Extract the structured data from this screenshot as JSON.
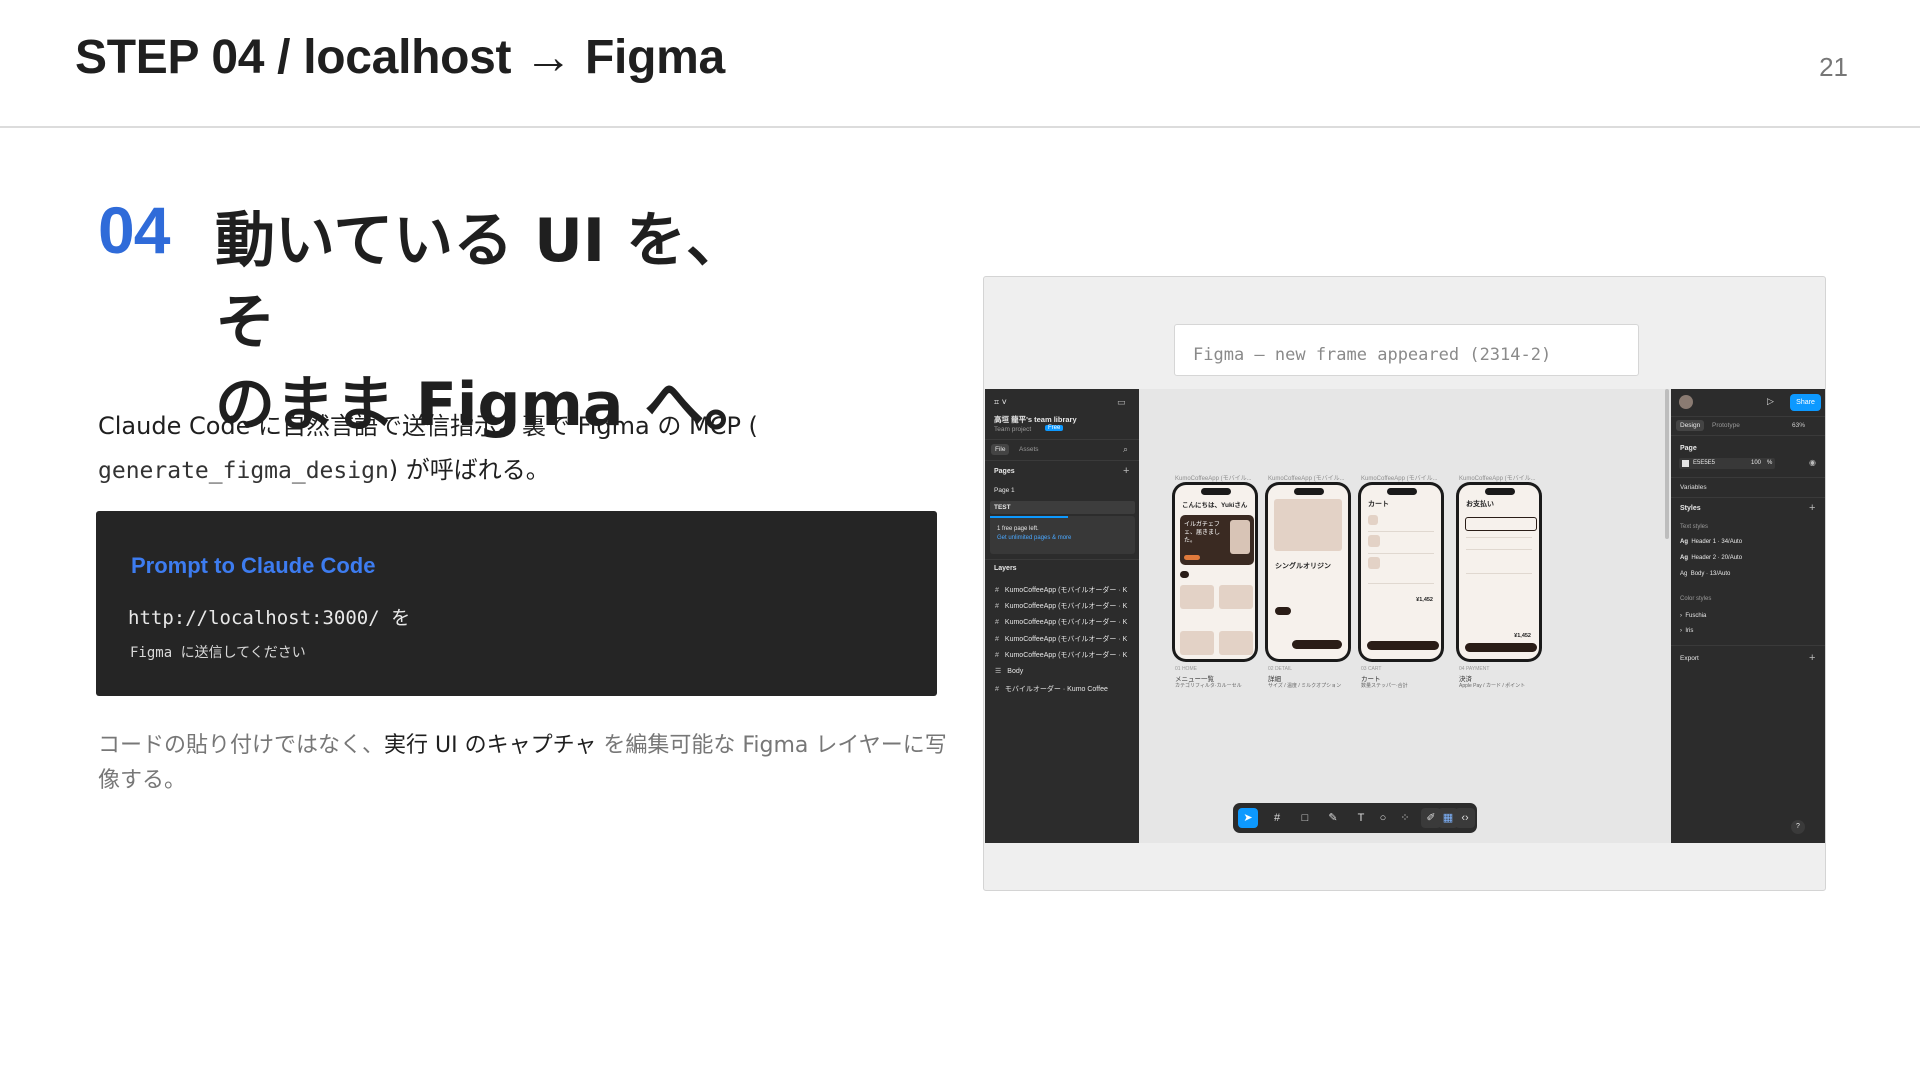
{
  "header": {
    "title": "STEP 04 / localhost → Figma",
    "page_number": "21"
  },
  "step": {
    "number": "04",
    "heading_line1": "動いている UI を、 そ",
    "heading_line2": "のまま Figma へ。"
  },
  "description": {
    "part1": "Claude Code に自然言語で送信指示。裏で Figma の MCP (",
    "code": "generate_figma_design",
    "part2": ") が呼ばれる。"
  },
  "prompt": {
    "label": "Prompt to Claude Code",
    "line1": "http://localhost:3000/ を",
    "line2": "Figma に送信してください"
  },
  "note": {
    "part1": "コードの貼り付けではなく、",
    "emphasis": "実行 UI のキャプチャ",
    "part2": " を編集可能な Figma レイヤーに写像する。"
  },
  "screenshot": {
    "caption": "Figma — new frame appeared (2314-2)",
    "left_panel": {
      "team": "高垣 龍平's team library",
      "project": "Team project",
      "plan_badge": "Free",
      "tabs": [
        "File",
        "Assets"
      ],
      "pages_label": "Pages",
      "pages": [
        "Page 1",
        "TEST"
      ],
      "free_notice": "1 free page left.",
      "upgrade_link": "Get unlimited pages & more",
      "layers_label": "Layers",
      "layers": [
        "KumoCoffeeApp (モバイルオーダー · K",
        "KumoCoffeeApp (モバイルオーダー · K",
        "KumoCoffeeApp (モバイルオーダー · K",
        "KumoCoffeeApp (モバイルオーダー · K",
        "KumoCoffeeApp (モバイルオーダー · K",
        "Body",
        "モバイルオーダー · Kumo Coffee"
      ]
    },
    "canvas": {
      "frame_label": "KumoCoffeeApp (モバイル...",
      "phones": [
        {
          "top": "こんにちは、Yukiさん",
          "screen_id": "01 HOME",
          "title": "メニュー一覧",
          "subtitle": "カテゴリフィルタ·カルーセル",
          "hero_text": "イルガチェフェ、届きました。"
        },
        {
          "top": "シングルオリジン",
          "screen_id": "02 DETAIL",
          "title": "詳細",
          "subtitle": "サイズ / 温度 / ミルクオプション",
          "hero_text": ""
        },
        {
          "top": "カート",
          "screen_id": "03 CART",
          "title": "カート",
          "subtitle": "数量ステッパー·合計",
          "hero_text": ""
        },
        {
          "top": "お支払い",
          "screen_id": "04 PAYMENT",
          "title": "決済",
          "subtitle": "Apple Pay / カード / ポイント",
          "hero_text": ""
        }
      ],
      "prices": [
        "¥1,452",
        "¥1,452"
      ]
    },
    "right_panel": {
      "share": "Share",
      "tabs": [
        "Design",
        "Prototype"
      ],
      "zoom": "63%",
      "page_label": "Page",
      "page_color": "E5E5E5",
      "opacity": "100",
      "opacity_unit": "%",
      "variables_label": "Variables",
      "styles_label": "Styles",
      "text_styles_label": "Text styles",
      "text_styles": [
        "Header 1 · 34/Auto",
        "Header 2 · 20/Auto",
        "Body · 13/Auto"
      ],
      "color_styles_label": "Color styles",
      "color_styles": [
        "Fuschia",
        "Iris"
      ],
      "export_label": "Export",
      "help": "?"
    }
  }
}
